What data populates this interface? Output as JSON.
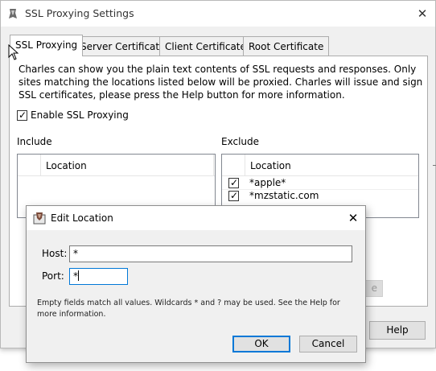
{
  "window": {
    "title": "SSL Proxying Settings",
    "close_glyph": "✕"
  },
  "tabs": [
    {
      "label": "SSL Proxying",
      "active": true
    },
    {
      "label": "Server Certificates",
      "active": false
    },
    {
      "label": "Client Certificates",
      "active": false
    },
    {
      "label": "Root Certificate",
      "active": false
    }
  ],
  "description": "Charles can show you the plain text contents of SSL requests and responses. Only sites matching the locations listed below will be proxied. Charles will issue and sign SSL certificates, please press the Help button for more information.",
  "enable_ssl": {
    "label": "Enable SSL Proxying",
    "checked": true
  },
  "include": {
    "label": "Include",
    "column": "Location",
    "rows": []
  },
  "exclude": {
    "label": "Exclude",
    "column": "Location",
    "rows": [
      {
        "location": "*apple*",
        "enabled": true
      },
      {
        "location": "*mzstatic.com",
        "enabled": true
      }
    ]
  },
  "buttons": {
    "remove_partial": "e",
    "help": "Help"
  },
  "dialog": {
    "title": "Edit Location",
    "close_glyph": "✕",
    "host_label": "Host:",
    "host_value": "*",
    "port_label": "Port:",
    "port_value": "*",
    "hint": "Empty fields match all values. Wildcards * and ? may be used. See the Help for more information.",
    "ok_label": "OK",
    "cancel_label": "Cancel"
  },
  "colors": {
    "accent": "#0078d7",
    "window_bg": "#f0f0f0",
    "panel_bg": "#ffffff"
  }
}
